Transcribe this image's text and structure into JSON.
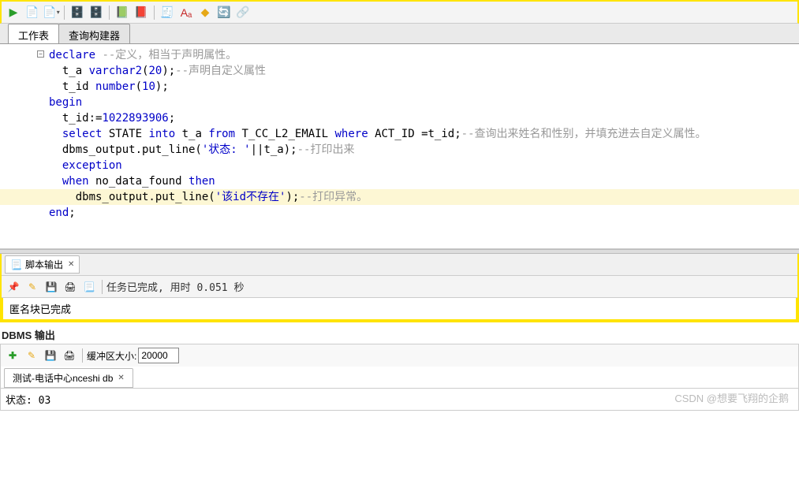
{
  "tabs": {
    "worksheet": "工作表",
    "query_builder": "查询构建器"
  },
  "toolbar": {
    "run_icon": "▶",
    "save_icon": "📄",
    "save2_icon": "📄",
    "db1_icon": "🗄️",
    "db2_icon": "🗄️",
    "exec1_icon": "📗",
    "exec2_icon": "📕",
    "sql_icon": "🧾",
    "font_icon": "Aₐ",
    "eraser_icon": "◆",
    "refresh_icon": "🔄",
    "chain_icon": "🔗"
  },
  "code": {
    "l1_kw": "declare",
    "l1_com": " --定义，相当于声明属性。",
    "l2_a": "  t_a ",
    "l2_dt": "varchar2",
    "l2_b": "(",
    "l2_n": "20",
    "l2_c": ");",
    "l2_com": "--声明自定义属性",
    "l3_a": "  t_id ",
    "l3_dt": "number",
    "l3_b": "(",
    "l3_n": "10",
    "l3_c": ");",
    "l4_kw": "begin",
    "l5_a": "  t_id:=",
    "l5_n": "1022893906",
    "l5_b": ";",
    "l6_a": "  ",
    "l6_kw1": "select",
    "l6_b": " STATE ",
    "l6_kw2": "into",
    "l6_c": " t_a ",
    "l6_kw3": "from",
    "l6_d": " T_CC_L2_EMAIL ",
    "l6_kw4": "where",
    "l6_e": " ACT_ID =t_id;",
    "l6_com": "--查询出来姓名和性别，并填充进去自定义属性。",
    "l7_a": "  dbms_output.put_line(",
    "l7_s": "'状态: '",
    "l7_b": "||t_a);",
    "l7_com": "--打印出来",
    "l8_kw": "  exception",
    "l9_a": "  ",
    "l9_kw": "when",
    "l9_b": " no_data_found ",
    "l9_kw2": "then",
    "l10_a": "    dbms_output.put_line(",
    "l10_s": "'该id不存在'",
    "l10_b": ");",
    "l10_com": "--打印异常。",
    "l11_kw": "end",
    "l11_b": ";"
  },
  "output_panel": {
    "tab_title": "脚本输出",
    "pin_icon": "📌",
    "pencil_icon": "✎",
    "save_icon": "💾",
    "print_icon": "🖨",
    "list_icon": "📃",
    "status": "任务已完成, 用时 0.051 秒",
    "body": "匿名块已完成"
  },
  "dbms_panel": {
    "title": "DBMS 输出",
    "add_icon": "✚",
    "pencil_icon": "✎",
    "save_icon": "💾",
    "print_icon": "🖨",
    "buffer_label": "缓冲区大小:",
    "buffer_value": "20000",
    "tab_title": "测试-电话中心nceshi db",
    "body": "状态: 03"
  },
  "watermark": "CSDN @想要飞翔的企鹅"
}
